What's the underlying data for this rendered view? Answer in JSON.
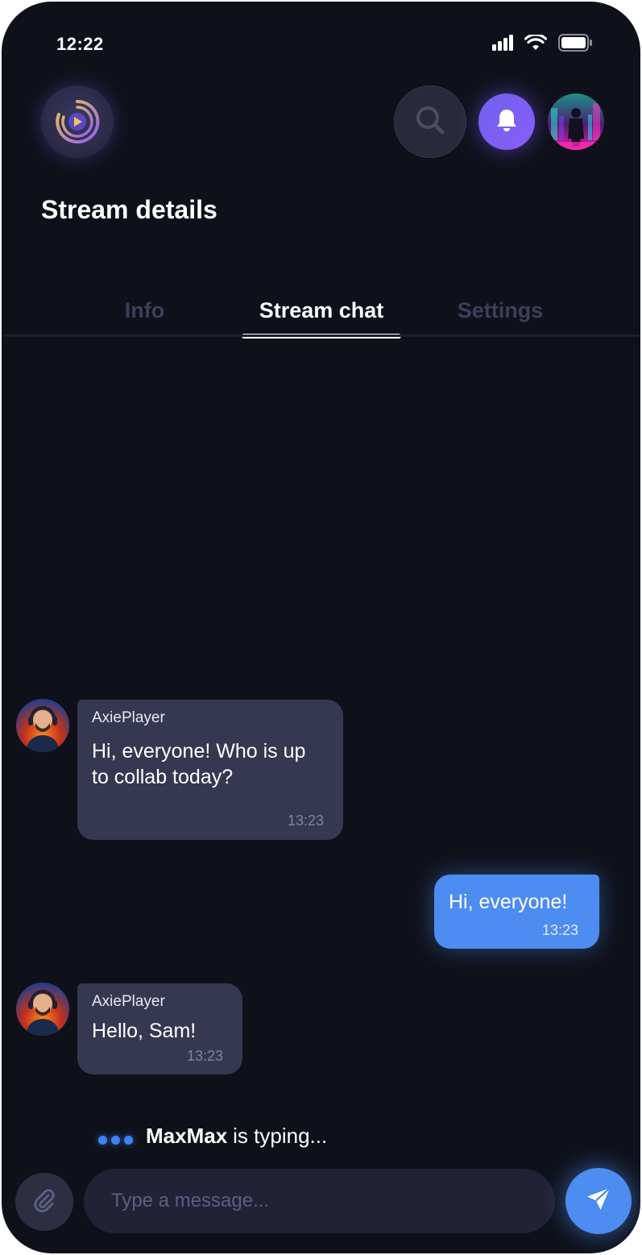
{
  "status_bar": {
    "time": "12:22",
    "icons": [
      "signal-icon",
      "wifi-icon",
      "battery-icon"
    ]
  },
  "header": {
    "title": "Stream details",
    "icons": {
      "logo": "stream-logo-icon",
      "search": "search-icon",
      "notifications": "bell-icon",
      "profile": "profile-avatar"
    }
  },
  "tabs": [
    {
      "label": "Info",
      "active": false
    },
    {
      "label": "Stream chat",
      "active": true
    },
    {
      "label": "Settings",
      "active": false
    }
  ],
  "messages": [
    {
      "direction": "incoming",
      "sender": "AxiePlayer",
      "text": "Hi, everyone! Who is up to collab today?",
      "time": "13:23"
    },
    {
      "direction": "outgoing",
      "text": "Hi, everyone!",
      "time": "13:23"
    },
    {
      "direction": "incoming",
      "sender": "AxiePlayer",
      "text": "Hello, Sam!",
      "time": "13:23"
    }
  ],
  "typing": {
    "name": "MaxMax",
    "suffix": "is typing..."
  },
  "composer": {
    "placeholder": "Type a message...",
    "attach_icon": "paperclip-icon",
    "send_icon": "send-icon"
  },
  "colors": {
    "background": "#0f111a",
    "incoming_bubble": "#363750",
    "outgoing_bubble": "#4d8cf0",
    "accent_purple": "#7a5cf4",
    "inactive_tab": "#3c3f5a"
  }
}
